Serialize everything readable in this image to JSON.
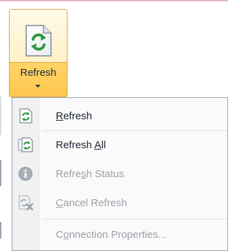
{
  "ribbon": {
    "button": {
      "label": "Refresh",
      "icon": "refresh-document-icon"
    }
  },
  "menu": {
    "items": [
      {
        "label_pre": "",
        "label_key": "R",
        "label_post": "efresh",
        "icon": "refresh-icon",
        "enabled": true
      },
      {
        "label_pre": "Refresh ",
        "label_key": "A",
        "label_post": "ll",
        "icon": "refresh-all-icon",
        "enabled": true
      },
      {
        "label_pre": "Refre",
        "label_key": "s",
        "label_post": "h Status",
        "icon": "info-icon",
        "enabled": false
      },
      {
        "label_pre": "",
        "label_key": "C",
        "label_post": "ancel Refresh",
        "icon": "cancel-refresh-icon",
        "enabled": false
      },
      {
        "label_pre": "C",
        "label_key": "o",
        "label_post": "nnection Properties...",
        "icon": "",
        "enabled": false
      }
    ]
  }
}
